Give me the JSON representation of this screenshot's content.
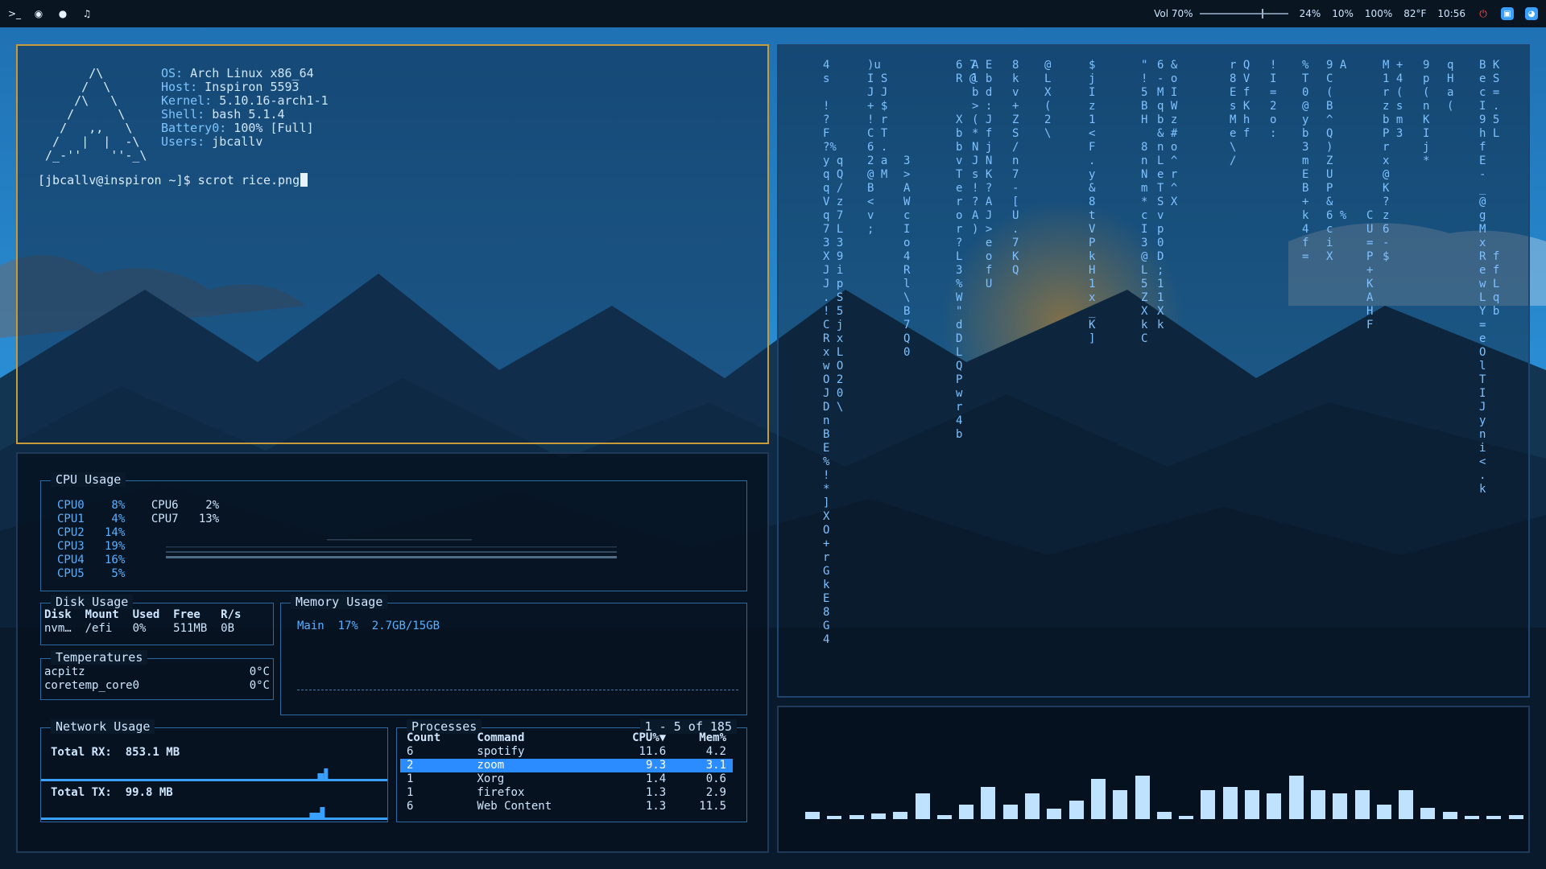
{
  "topbar": {
    "left_icons": [
      "terminal-icon",
      "globe-icon",
      "chat-icon",
      "music-icon"
    ],
    "volume_label": "Vol 70%",
    "volume_level": 0.7,
    "cpu": "24%",
    "mem": "10%",
    "battery": "100%",
    "temp": "82°F",
    "time": "10:56",
    "right_icons": [
      "power-icon",
      "zoom-icon",
      "discord-icon"
    ]
  },
  "terminal": {
    "logo": "       /\\\n      /  \\\n     /\\   \\\n    /      \\\n   /   ,,   \\\n  /   |  |  -\\\n /_-''    ''-_\\",
    "info": [
      {
        "key": "OS:",
        "value": " Arch Linux x86_64"
      },
      {
        "key": "Host:",
        "value": " Inspiron 5593"
      },
      {
        "key": "Kernel:",
        "value": " 5.10.16-arch1-1"
      },
      {
        "key": "Shell:",
        "value": " bash 5.1.4"
      },
      {
        "key": "Battery0:",
        "value": " 100% [Full]"
      },
      {
        "key": "Users:",
        "value": " jbcallv"
      }
    ],
    "prompt": "[jbcallv@inspiron ~]$ scrot rice.png"
  },
  "monitor": {
    "cpu": {
      "title": "CPU Usage",
      "left": [
        [
          "CPU0",
          "8%"
        ],
        [
          "CPU1",
          "4%"
        ],
        [
          "CPU2",
          "14%"
        ],
        [
          "CPU3",
          "19%"
        ],
        [
          "CPU4",
          "16%"
        ],
        [
          "CPU5",
          "5%"
        ]
      ],
      "right": [
        [
          "CPU6",
          "2%"
        ],
        [
          "CPU7",
          "13%"
        ]
      ]
    },
    "disk": {
      "title": "Disk Usage",
      "headers": [
        "Disk",
        "Mount",
        "Used",
        "Free",
        "R/s"
      ],
      "row": [
        "nvm…",
        "/efi",
        "0%",
        "511MB",
        "0B"
      ]
    },
    "memory": {
      "title": "Memory Usage",
      "main_label": "Main",
      "percent": "17%",
      "amount": "2.7GB/15GB"
    },
    "temps": {
      "title": "Temperatures",
      "rows": [
        [
          "acpitz",
          "0°C"
        ],
        [
          "coretemp_core0",
          "0°C"
        ]
      ]
    },
    "network": {
      "title": "Network Usage",
      "rx_label": "Total RX:",
      "rx_value": "853.1 MB",
      "tx_label": "Total TX:",
      "tx_value": "99.8 MB"
    },
    "processes": {
      "title": "Processes",
      "range": "1 - 5 of 185",
      "headers": [
        "Count",
        "Command",
        "CPU%▼",
        "Mem%"
      ],
      "rows": [
        [
          "6",
          "spotify",
          "11.6",
          "4.2"
        ],
        [
          "2",
          "zoom",
          "9.3",
          "3.1"
        ],
        [
          "1",
          "Xorg",
          "1.4",
          "0.6"
        ],
        [
          "1",
          "firefox",
          "1.3",
          "2.9"
        ],
        [
          "6",
          "Web Content",
          "1.3",
          "11.5"
        ]
      ],
      "selected_row": 1
    }
  },
  "matrix": {
    "columns": [
      "4\ns\n\n!\n?\nF\n?%\ny q\nq Q\nq /\nV z\nq 7\n7 L\n3 3\nX 9\nJ i\nJ p\n. S\n! 5\nC j\nR x\nx L\nw O\nO 2\nJ 0\nD \\\nn\nB\nE\n%\n!\n*\n]\nX\nO\n+\nr\nG\nk\nE\n8\nG\n4",
      ")u\nI S\nJ J\n+ $\n! r\nC T\n6 .\n2 a\n@ M\nB\n<\nv\n;",
      "\n\n\n\n\n\n\n3\n>\nA\nW\nc\nI\no\n4\nR\nl\n\\\nB\n7\nQ\n0",
      "6 7\nR @\n\n\nX\nb\nb\nv\nT\ne\nr\no\nr\n?\nL\n3\n%\nW\n\"\nd\nD\nL\nQ\nP\nw\nr\n4\nb",
      "A E\nl b\nb d\n> :\n( J\n* f\nN j\nJ N\ns K\n! ?\n? A\nA J\n) >\n  e\n  o\n  f\n  U",
      "8\nk\nv\n+\nZ\nS\n/\nn\n7\n-\n[\nU\n.\n7\nK\nQ",
      "@\nL\nX\n(\n2\n\\",
      "$\nj\nI\nz\n1\n<\nF\n.\ny\n&\n8\nt\nV\nP\nk\nH\n1\nx\n_\nK\n]",
      "\"\n!\n5\nB\nH\n \n8\nn\nN\nm\n*\nc\nI\n3\n@\nL\n5\nZ\nX\nk\nC",
      "6 &\n- o\nM I\nq W\nb z\n& #\nn o\nL ^\ne r\nT ^\nS X\nv\np\n0\nD\n;\n1\n1\nX\nk",
      "r Q\n8 V\nE f\ns K\nM h\ne f\n\\\n/",
      "!\nI\n=\n2\no\n:",
      "%\nT\n0\n@\ny\nb\n3\nm\nE\nB\n+\nk\n4\nf\n=",
      "9 A\nC\n(\nB\n^\nQ\n)\nZ\nU\nP\n&\n6 %\nc\ni\nX",
      "\n\n\n\n\n\n\n\n\n\n\nC\nU\n=\nP\n+\nK\nA\nH\nF",
      "M +\n1 4\nr (\nz s\nb m\nP 3\nr\nx\n@\nK\n?\nz\n6\n-\n$",
      "9\np\n(\nn\nK\nI\nj\n*",
      "q\nH\na\n(",
      "B K\ne S\nc =\nI .\n9 5\nh L\nf\nE\n-\n_\n@\ng\nM\nx\nR f\ne f\nw L\nL q\nY b\n=\ne\nO\nl\nT\nI\nJ\ny\nn\ni\n<\n.\nk"
    ],
    "cava_levels": [
      0.05,
      0.02,
      0.03,
      0.04,
      0.05,
      0.18,
      0.03,
      0.1,
      0.22,
      0.1,
      0.18,
      0.07,
      0.13,
      0.28,
      0.2,
      0.3,
      0.05,
      0.02,
      0.2,
      0.22,
      0.2,
      0.18,
      0.3,
      0.2,
      0.18,
      0.2,
      0.1,
      0.2,
      0.08,
      0.05,
      0.02,
      0.02,
      0.03
    ]
  }
}
